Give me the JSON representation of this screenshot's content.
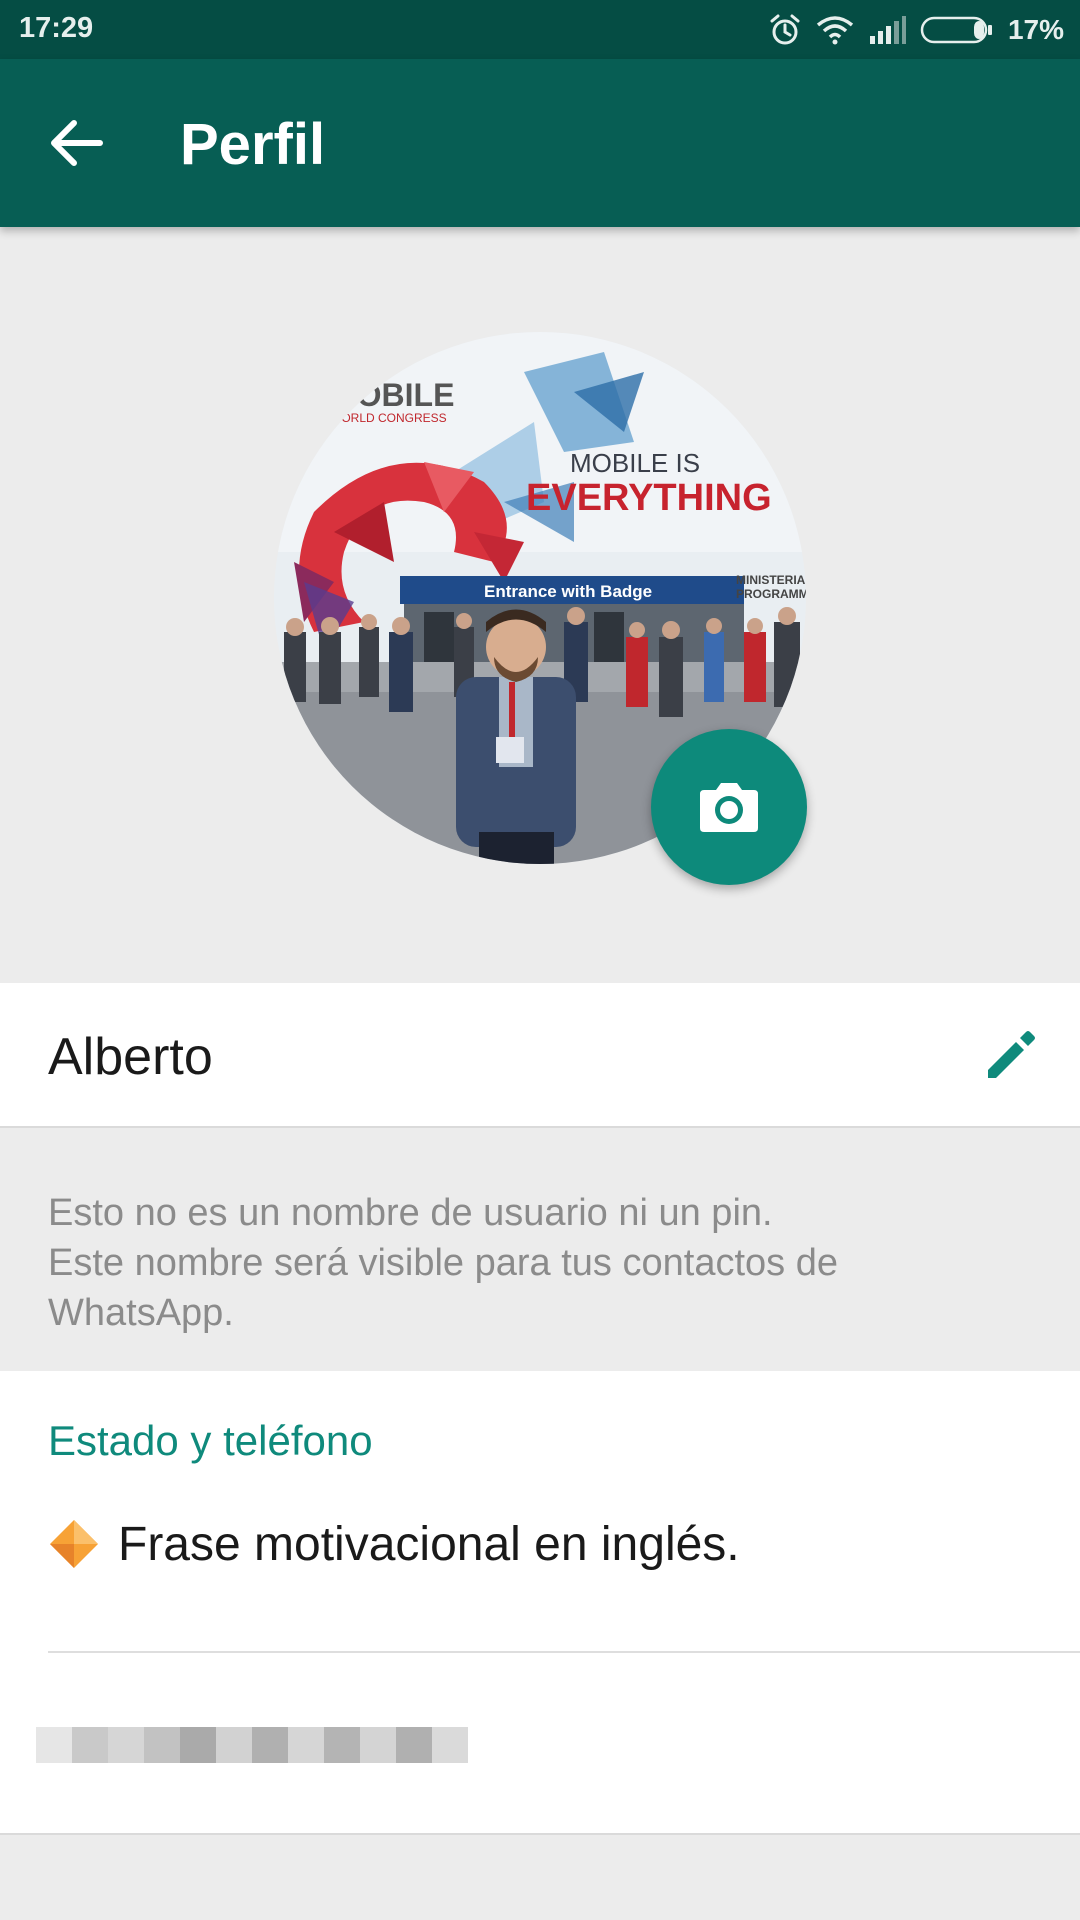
{
  "status_bar": {
    "time": "17:29",
    "battery_percent": "17%",
    "icons": [
      "alarm-icon",
      "wifi-icon",
      "signal-icon",
      "battery-icon"
    ]
  },
  "app_bar": {
    "back_icon": "arrow-back-icon",
    "title": "Perfil",
    "color": "#075e54"
  },
  "profile": {
    "photo_text": {
      "brand": "MOBILE",
      "brand_sub": "WORLD CONGRESS",
      "headline_1": "MOBILE IS",
      "headline_2": "EVERYTHING",
      "banner": "Entrance with Badge",
      "side_1": "MINISTERIAL",
      "side_2": "PROGRAMME"
    },
    "camera_icon": "camera-icon",
    "name": "Alberto",
    "edit_icon": "pencil-icon",
    "hint_lines": [
      "Esto no es un nombre de usuario ni un pin.",
      "Este nombre será visible para tus contactos de",
      "WhatsApp."
    ]
  },
  "status_section": {
    "title": "Estado y teléfono",
    "status_emoji_icon": "orange-diamond-icon",
    "status_text": "Frase motivacional en inglés.",
    "phone_number_blurred": true
  },
  "colors": {
    "accent": "#0f8a7c",
    "fab": "#0d8a7b",
    "status_bar": "#054d44"
  }
}
